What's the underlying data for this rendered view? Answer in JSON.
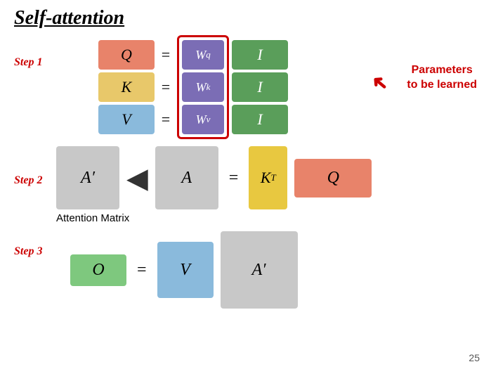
{
  "title": "Self-attention",
  "step1": {
    "label": "Step 1",
    "q_label": "Q",
    "k_label": "K",
    "v_label": "V",
    "eq": "=",
    "wq_label": "W",
    "wq_sup": "q",
    "wk_label": "W",
    "wk_sup": "k",
    "wv_label": "W",
    "wv_sup": "v",
    "i_label": "I",
    "params_line1": "Parameters",
    "params_line2": "to be learned"
  },
  "step2": {
    "label": "Step 2",
    "a_prime_label": "A′",
    "a_label": "A",
    "eq": "=",
    "kt_label": "K",
    "kt_sup": "T",
    "q_label": "Q",
    "attention_matrix_label": "Attention Matrix"
  },
  "step3": {
    "label": "Step 3",
    "o_label": "O",
    "eq": "=",
    "v_label": "V",
    "a_prime_label": "A′"
  },
  "page_number": "25"
}
